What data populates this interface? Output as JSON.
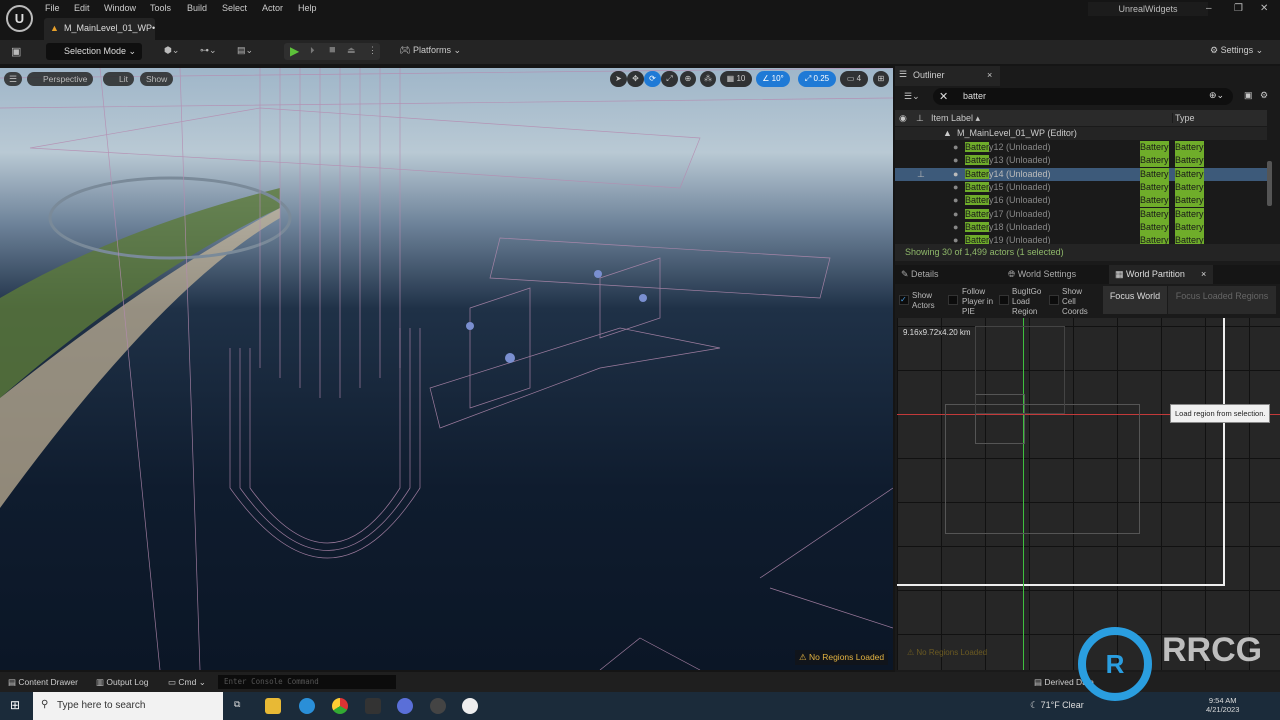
{
  "menu": [
    "File",
    "Edit",
    "Window",
    "Tools",
    "Build",
    "Select",
    "Actor",
    "Help"
  ],
  "level_tab": "M_MainLevel_01_WP•",
  "app_name": "UnrealWidgets",
  "toolbar": {
    "selection_mode": "Selection Mode",
    "platforms": "Platforms",
    "settings": "Settings"
  },
  "viewport": {
    "perspective": "Perspective",
    "lit": "Lit",
    "show": "Show",
    "grid_snap": "10",
    "rot_snap": "10°",
    "scale_snap": "0.25",
    "cam_speed": "4",
    "warning": "No Regions Loaded"
  },
  "outliner": {
    "title": "Outliner",
    "search_value": "batter",
    "col_label": "Item Label",
    "col_type": "Type",
    "level_row": "M_MainLevel_01_WP (Editor)",
    "rows": [
      {
        "hl": "Batter",
        "rest": "y12 (Unloaded)",
        "t1": "Battery",
        "t2": "Battery"
      },
      {
        "hl": "Batter",
        "rest": "y13 (Unloaded)",
        "t1": "Battery",
        "t2": "Battery"
      },
      {
        "hl": "Batter",
        "rest": "y14 (Unloaded)",
        "t1": "Battery",
        "t2": "Battery",
        "selected": true
      },
      {
        "hl": "Batter",
        "rest": "y15 (Unloaded)",
        "t1": "Battery",
        "t2": "Battery"
      },
      {
        "hl": "Batter",
        "rest": "y16 (Unloaded)",
        "t1": "Battery",
        "t2": "Battery"
      },
      {
        "hl": "Batter",
        "rest": "y17 (Unloaded)",
        "t1": "Battery",
        "t2": "Battery"
      },
      {
        "hl": "Batter",
        "rest": "y18 (Unloaded)",
        "t1": "Battery",
        "t2": "Battery"
      },
      {
        "hl": "Batter",
        "rest": "y19 (Unloaded)",
        "t1": "Battery",
        "t2": "Battery"
      }
    ],
    "status": "Showing 30 of 1,499 actors (1 selected)"
  },
  "tabs": {
    "details": "Details",
    "world_settings": "World Settings",
    "world_partition": "World Partition"
  },
  "wp": {
    "show_actors": "Show Actors",
    "follow_player": "Follow Player in PIE",
    "bugitgo": "BugItGo Load Region",
    "show_cell_coords": "Show Cell Coords",
    "focus_world": "Focus World",
    "focus_loaded": "Focus Loaded Regions",
    "size": "9.16x9.72x4.20 km",
    "tooltip": "Load region from selection.",
    "warning": "No Regions Loaded",
    "show_actors_checked": true
  },
  "bottom": {
    "content_drawer": "Content Drawer",
    "output_log": "Output Log",
    "cmd": "Cmd",
    "console_placeholder": "Enter Console Command",
    "derived_data": "Derived Data"
  },
  "taskbar": {
    "search_placeholder": "Type here to search",
    "weather": "71°F  Clear",
    "time": "9:54 AM",
    "date": "4/21/2023"
  },
  "watermark": "RRCG 人人素材"
}
